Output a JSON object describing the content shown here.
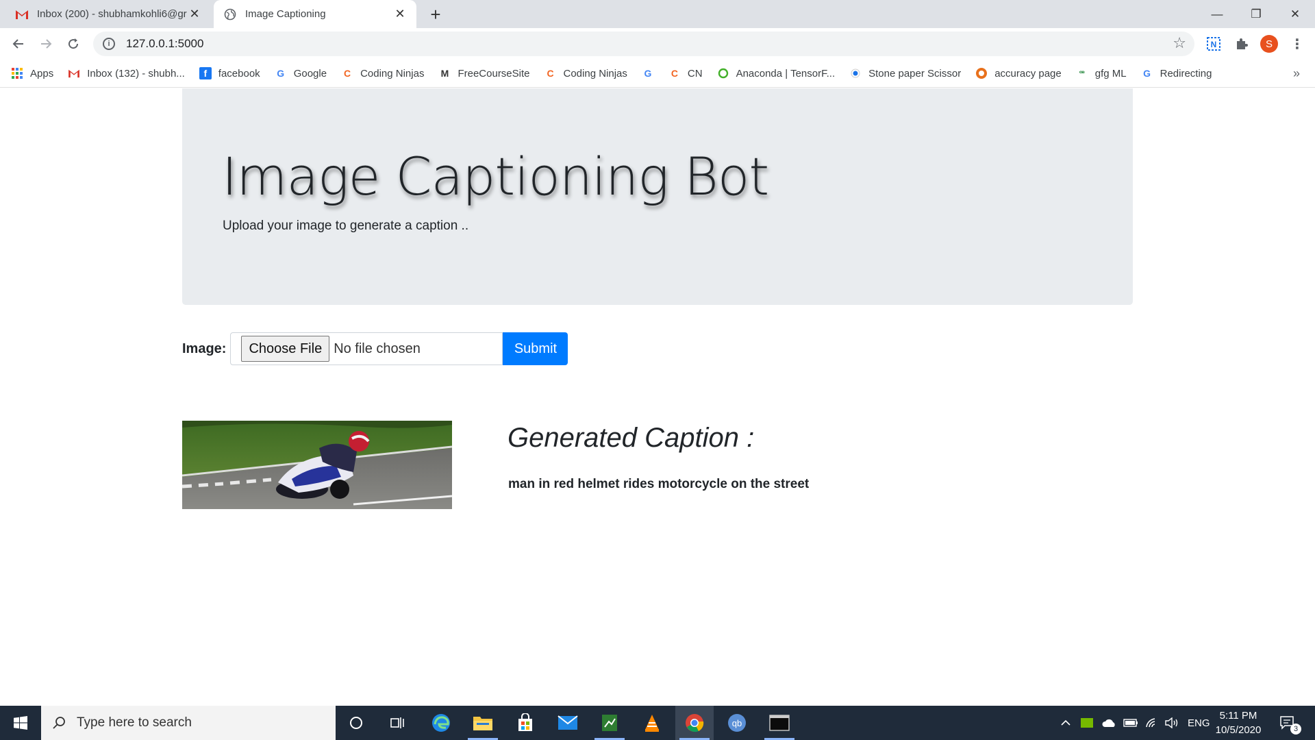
{
  "browser": {
    "tabs": [
      {
        "title": "Inbox (200) - shubhamkohli6@gr",
        "icon": "gmail-icon"
      },
      {
        "title": "Image Captioning",
        "icon": "globe-icon"
      }
    ],
    "url": "127.0.0.1:5000",
    "profile_initial": "S",
    "bookmarks": [
      {
        "label": "Apps",
        "icon": "apps-grid-icon"
      },
      {
        "label": "Inbox (132) - shubh...",
        "icon": "gmail-icon"
      },
      {
        "label": "facebook",
        "icon": "facebook-icon"
      },
      {
        "label": "Google",
        "icon": "google-icon"
      },
      {
        "label": "Coding Ninjas",
        "icon": "coding-ninjas-icon"
      },
      {
        "label": "FreeCourseSite",
        "icon": "freecoursesite-icon"
      },
      {
        "label": "Coding Ninjas",
        "icon": "coding-ninjas-icon"
      },
      {
        "label": "",
        "icon": "google-icon"
      },
      {
        "label": "CN",
        "icon": "coding-ninjas-icon"
      },
      {
        "label": "Anaconda | TensorF...",
        "icon": "anaconda-icon"
      },
      {
        "label": "Stone paper Scissor",
        "icon": "dot-icon"
      },
      {
        "label": "accuracy page",
        "icon": "accuracy-icon"
      },
      {
        "label": "gfg ML",
        "icon": "gfg-icon"
      },
      {
        "label": "Redirecting",
        "icon": "google-icon"
      }
    ]
  },
  "page": {
    "title": "Image Captioning Bot",
    "subtitle": "Upload your image to generate a caption ..",
    "form": {
      "label": "Image:",
      "choose_file": "Choose File",
      "file_status": "No file chosen",
      "submit": "Submit"
    },
    "result": {
      "heading": "Generated Caption :",
      "caption": "man in red helmet rides motorcycle on the street"
    }
  },
  "taskbar": {
    "search_placeholder": "Type here to search",
    "language": "ENG",
    "time": "5:11 PM",
    "date": "10/5/2020",
    "notification_count": "3"
  },
  "colors": {
    "accent": "#007bff",
    "jumbotron": "#e9ecef",
    "taskbar": "#1f2b3a"
  }
}
